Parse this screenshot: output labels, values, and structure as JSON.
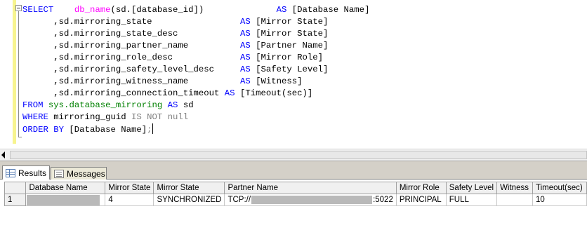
{
  "editor": {
    "lines": [
      [
        {
          "t": "SELECT",
          "c": "kw"
        },
        {
          "t": "    "
        },
        {
          "t": "db_name",
          "c": "fn"
        },
        {
          "t": "(sd.[database_id])              "
        },
        {
          "t": "AS",
          "c": "kw"
        },
        {
          "t": " [Database Name]"
        }
      ],
      [
        {
          "t": "      ,sd.mirroring_state                 "
        },
        {
          "t": "AS",
          "c": "kw"
        },
        {
          "t": " [Mirror State]"
        }
      ],
      [
        {
          "t": "      ,sd.mirroring_state_desc            "
        },
        {
          "t": "AS",
          "c": "kw"
        },
        {
          "t": " [Mirror State]"
        }
      ],
      [
        {
          "t": "      ,sd.mirroring_partner_name          "
        },
        {
          "t": "AS",
          "c": "kw"
        },
        {
          "t": " [Partner Name]"
        }
      ],
      [
        {
          "t": "      ,sd.mirroring_role_desc             "
        },
        {
          "t": "AS",
          "c": "kw"
        },
        {
          "t": " [Mirror Role]"
        }
      ],
      [
        {
          "t": "      ,sd.mirroring_safety_level_desc     "
        },
        {
          "t": "AS",
          "c": "kw"
        },
        {
          "t": " [Safety Level]"
        }
      ],
      [
        {
          "t": "      ,sd.mirroring_witness_name          "
        },
        {
          "t": "AS",
          "c": "kw"
        },
        {
          "t": " [Witness]"
        }
      ],
      [
        {
          "t": "      ,sd.mirroring_connection_timeout "
        },
        {
          "t": "AS",
          "c": "kw"
        },
        {
          "t": " [Timeout(sec)]"
        }
      ],
      [
        {
          "t": "FROM",
          "c": "kw"
        },
        {
          "t": " "
        },
        {
          "t": "sys.database_mirroring",
          "c": "sys"
        },
        {
          "t": " "
        },
        {
          "t": "AS",
          "c": "kw"
        },
        {
          "t": " sd"
        }
      ],
      [
        {
          "t": "WHERE",
          "c": "kw"
        },
        {
          "t": " mirroring_guid "
        },
        {
          "t": "IS NOT null",
          "c": "op"
        }
      ],
      [
        {
          "t": "ORDER BY",
          "c": "kw"
        },
        {
          "t": " [Database Name]"
        },
        {
          "t": ";",
          "c": "op"
        }
      ]
    ]
  },
  "tabs": {
    "results_label": "Results",
    "messages_label": "Messages"
  },
  "grid": {
    "columns": [
      "",
      "Database Name",
      "Mirror State",
      "Mirror State",
      "Partner Name",
      "Mirror Role",
      "Safety Level",
      "Witness",
      "Timeout(sec)"
    ],
    "row": {
      "num": "1",
      "mirror_state": "4",
      "mirror_state_desc": "SYNCHRONIZED",
      "partner_prefix": "TCP://",
      "partner_suffix": ":5022",
      "role": "PRINCIPAL",
      "safety": "FULL",
      "witness": "",
      "timeout": "10"
    }
  },
  "colors": {
    "keyword": "#0000ff",
    "function": "#ff00ff",
    "system_object": "#008000",
    "operator": "#808080"
  }
}
